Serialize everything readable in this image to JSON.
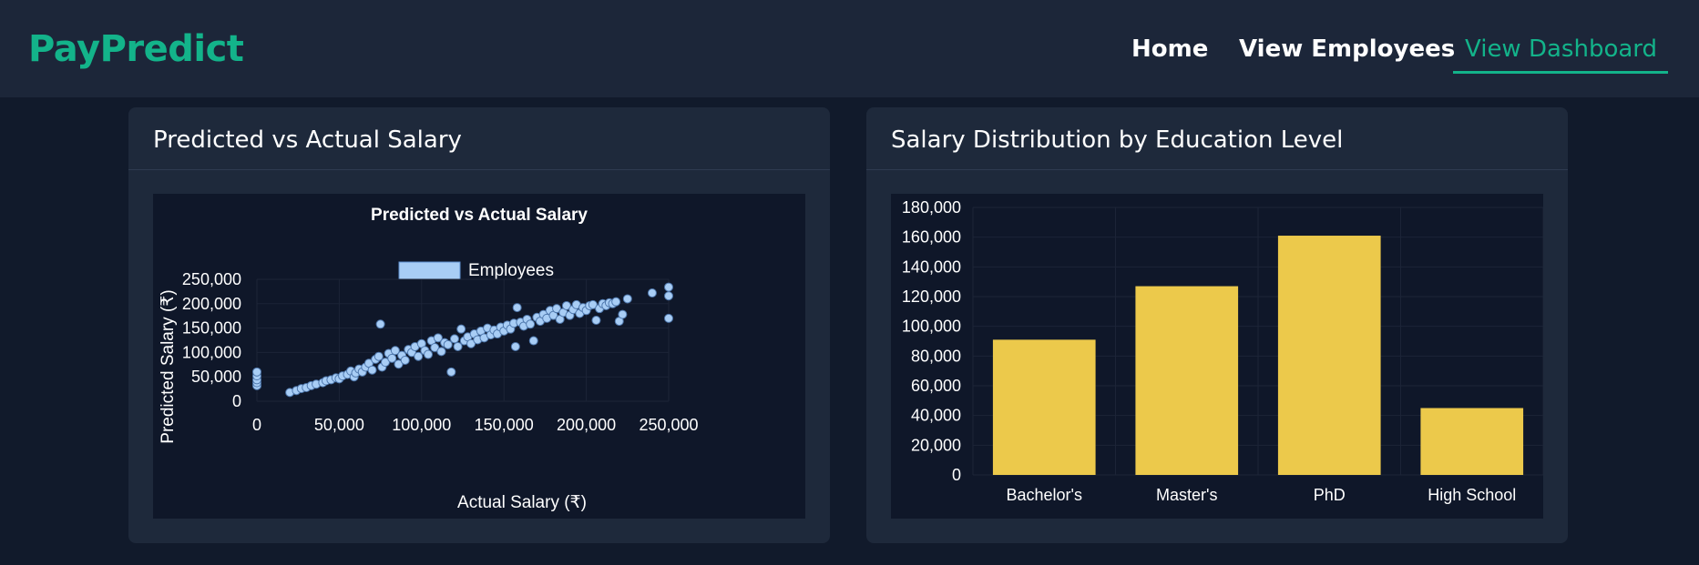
{
  "brand": {
    "name": "PayPredict"
  },
  "nav": {
    "items": [
      {
        "label": "Home"
      },
      {
        "label": "View Employees"
      },
      {
        "label": "View Dashboard",
        "active": true
      }
    ]
  },
  "colors": {
    "accent": "#13b38a",
    "navbar_bg": "#1c2639",
    "page_bg": "#111a2b",
    "card_bg": "#1e293b",
    "chart_bg": "#0f1729",
    "scatter_point": "#a8cdf5",
    "bar_fill": "#ecc94b"
  },
  "cards": {
    "scatter": {
      "title": "Predicted vs Actual Salary"
    },
    "bar": {
      "title": "Salary Distribution by Education Level"
    }
  },
  "chart_data": [
    {
      "type": "scatter",
      "title": "Predicted vs Actual Salary",
      "xlabel": "Actual Salary (₹)",
      "ylabel": "Predicted Salary (₹)",
      "legend": {
        "position": "top",
        "entries": [
          "Employees"
        ]
      },
      "xlim": [
        0,
        250000
      ],
      "ylim": [
        0,
        250000
      ],
      "xticks": [
        "0",
        "50,000",
        "100,000",
        "150,000",
        "200,000",
        "250,000"
      ],
      "yticks": [
        "0",
        "50,000",
        "100,000",
        "150,000",
        "200,000",
        "250,000"
      ],
      "grid": true,
      "series": [
        {
          "name": "Employees",
          "points": [
            [
              0,
              32000
            ],
            [
              0,
              38000
            ],
            [
              0,
              44000
            ],
            [
              0,
              52000
            ],
            [
              0,
              60000
            ],
            [
              20000,
              18000
            ],
            [
              24000,
              22000
            ],
            [
              27000,
              26000
            ],
            [
              30000,
              28000
            ],
            [
              33000,
              32000
            ],
            [
              36000,
              35000
            ],
            [
              40000,
              38000
            ],
            [
              42000,
              42000
            ],
            [
              45000,
              44000
            ],
            [
              48000,
              48000
            ],
            [
              50000,
              46000
            ],
            [
              52000,
              52000
            ],
            [
              55000,
              55000
            ],
            [
              57000,
              62000
            ],
            [
              59000,
              50000
            ],
            [
              60000,
              58000
            ],
            [
              62000,
              66000
            ],
            [
              64000,
              60000
            ],
            [
              66000,
              70000
            ],
            [
              68000,
              78000
            ],
            [
              70000,
              64000
            ],
            [
              72000,
              86000
            ],
            [
              74000,
              92000
            ],
            [
              75000,
              158000
            ],
            [
              76000,
              70000
            ],
            [
              78000,
              80000
            ],
            [
              80000,
              98000
            ],
            [
              82000,
              88000
            ],
            [
              84000,
              104000
            ],
            [
              86000,
              76000
            ],
            [
              88000,
              94000
            ],
            [
              90000,
              84000
            ],
            [
              92000,
              106000
            ],
            [
              94000,
              100000
            ],
            [
              96000,
              112000
            ],
            [
              98000,
              92000
            ],
            [
              100000,
              118000
            ],
            [
              102000,
              104000
            ],
            [
              104000,
              96000
            ],
            [
              106000,
              124000
            ],
            [
              108000,
              110000
            ],
            [
              110000,
              130000
            ],
            [
              112000,
              102000
            ],
            [
              114000,
              120000
            ],
            [
              116000,
              116000
            ],
            [
              118000,
              60000
            ],
            [
              120000,
              128000
            ],
            [
              122000,
              112000
            ],
            [
              124000,
              148000
            ],
            [
              126000,
              124000
            ],
            [
              128000,
              132000
            ],
            [
              130000,
              118000
            ],
            [
              132000,
              138000
            ],
            [
              134000,
              126000
            ],
            [
              136000,
              144000
            ],
            [
              138000,
              130000
            ],
            [
              140000,
              150000
            ],
            [
              142000,
              136000
            ],
            [
              144000,
              146000
            ],
            [
              146000,
              138000
            ],
            [
              148000,
              152000
            ],
            [
              150000,
              144000
            ],
            [
              152000,
              156000
            ],
            [
              154000,
              148000
            ],
            [
              156000,
              160000
            ],
            [
              157000,
              112000
            ],
            [
              158000,
              192000
            ],
            [
              160000,
              162000
            ],
            [
              162000,
              154000
            ],
            [
              164000,
              168000
            ],
            [
              166000,
              158000
            ],
            [
              168000,
              124000
            ],
            [
              170000,
              172000
            ],
            [
              172000,
              164000
            ],
            [
              174000,
              178000
            ],
            [
              176000,
              170000
            ],
            [
              178000,
              186000
            ],
            [
              180000,
              176000
            ],
            [
              182000,
              190000
            ],
            [
              184000,
              168000
            ],
            [
              186000,
              182000
            ],
            [
              188000,
              196000
            ],
            [
              190000,
              176000
            ],
            [
              192000,
              188000
            ],
            [
              194000,
              198000
            ],
            [
              196000,
              180000
            ],
            [
              198000,
              192000
            ],
            [
              200000,
              186000
            ],
            [
              202000,
              196000
            ],
            [
              204000,
              198000
            ],
            [
              206000,
              166000
            ],
            [
              208000,
              190000
            ],
            [
              210000,
              200000
            ],
            [
              212000,
              196000
            ],
            [
              214000,
              202000
            ],
            [
              216000,
              200000
            ],
            [
              218000,
              204000
            ],
            [
              220000,
              164000
            ],
            [
              222000,
              178000
            ],
            [
              225000,
              210000
            ],
            [
              240000,
              222000
            ],
            [
              250000,
              170000
            ],
            [
              250000,
              216000
            ],
            [
              250000,
              234000
            ]
          ]
        }
      ]
    },
    {
      "type": "bar",
      "title": "",
      "xlabel": "",
      "ylabel": "",
      "categories": [
        "Bachelor's",
        "Master's",
        "PhD",
        "High School"
      ],
      "values": [
        91000,
        127000,
        161000,
        45000
      ],
      "ylim": [
        0,
        180000
      ],
      "yticks": [
        "0",
        "20,000",
        "40,000",
        "60,000",
        "80,000",
        "100,000",
        "120,000",
        "140,000",
        "160,000",
        "180,000"
      ],
      "grid": true,
      "legend": null
    }
  ]
}
